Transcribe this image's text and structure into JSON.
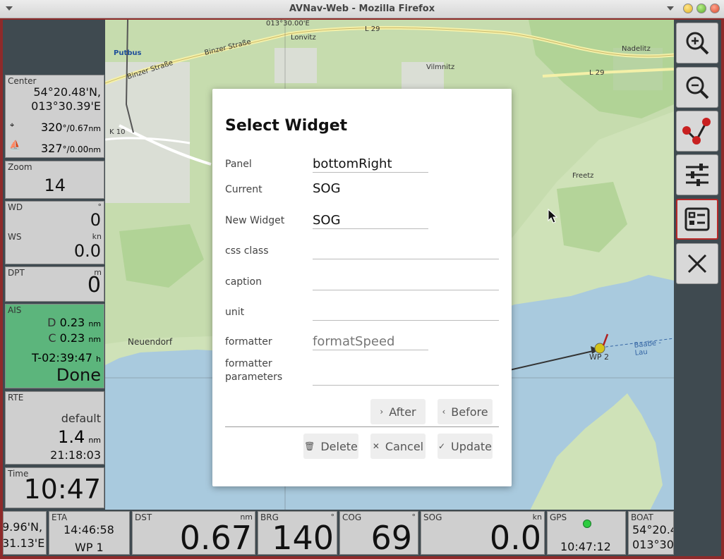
{
  "window": {
    "title": "AVNav-Web - Mozilla Firefox"
  },
  "map": {
    "labels": [
      "013°30.00'E",
      "Lonvitz",
      "L 29",
      "Nadelitz",
      "Putbus",
      "Binzer Straße",
      "Binzer Straße",
      "Vilmnitz",
      "L 29",
      "K 10",
      "Freetz",
      "Neuendorf",
      "Baabe - Lau",
      "WP 2"
    ]
  },
  "left": {
    "center": {
      "caption": "Center",
      "lat": "54°20.48'N,",
      "lon": "013°30.39'E",
      "r1": "320",
      "r1unit": "°/0.67",
      "r1nm": "nm",
      "r2": "327",
      "r2unit": "°/0.00",
      "r2nm": "nm"
    },
    "zoom": {
      "caption": "Zoom",
      "value": "14"
    },
    "wind": {
      "wd_caption": "WD",
      "wd_unit": "°",
      "wd_value": "0",
      "ws_caption": "WS",
      "ws_unit": "kn",
      "ws_value": "0.0"
    },
    "dpt": {
      "caption": "DPT",
      "unit": "m",
      "value": "0"
    },
    "ais": {
      "caption": "AIS",
      "d_label": "D",
      "d_value": "0.23",
      "d_unit": "nm",
      "c_label": "C",
      "c_value": "0.23",
      "c_unit": "nm",
      "t_value": "T-02:39:47",
      "t_unit": "h",
      "status": "Done",
      "bg": "#5cb57c"
    },
    "rte": {
      "caption": "RTE",
      "name": "default",
      "dist": "1.4",
      "dist_unit": "nm",
      "eta": "21:18:03"
    },
    "time": {
      "caption": "Time",
      "value": "10:47"
    }
  },
  "bottom": {
    "pos": {
      "line1": "9.96'N,",
      "line2": "31.13'E"
    },
    "eta": {
      "caption": "ETA",
      "time": "14:46:58",
      "wp": "WP 1"
    },
    "dst": {
      "caption": "DST",
      "unit": "nm",
      "value": "0.67"
    },
    "brg": {
      "caption": "BRG",
      "unit": "°",
      "value": "140"
    },
    "cog": {
      "caption": "COG",
      "unit": "°",
      "value": "69"
    },
    "sog": {
      "caption": "SOG",
      "unit": "kn",
      "value": "0.0"
    },
    "gps": {
      "caption": "GPS",
      "time": "10:47:12",
      "status_color": "#2ecc40"
    },
    "boat": {
      "caption": "BOAT",
      "line1": "54°20.4",
      "line2": "013°30"
    }
  },
  "dialog": {
    "title": "Select Widget",
    "panel_label": "Panel",
    "panel_value": "bottomRight",
    "current_label": "Current",
    "current_value": "SOG",
    "new_widget_label": "New Widget",
    "new_widget_value": "SOG",
    "css_class_label": "css class",
    "css_class_value": "",
    "caption_label": "caption",
    "caption_value": "",
    "unit_label": "unit",
    "unit_value": "",
    "formatter_label": "formatter",
    "formatter_value": "formatSpeed",
    "formatter_params_label1": "formatter",
    "formatter_params_label2": "parameters",
    "formatter_params_value": "",
    "after_label": "After",
    "before_label": "Before",
    "delete_label": "Delete",
    "cancel_label": "Cancel",
    "update_label": "Update"
  },
  "right_buttons": [
    "zoom-in-icon",
    "zoom-out-icon",
    "route-icon",
    "settings-sliders-icon",
    "widget-layout-icon",
    "close-icon"
  ]
}
